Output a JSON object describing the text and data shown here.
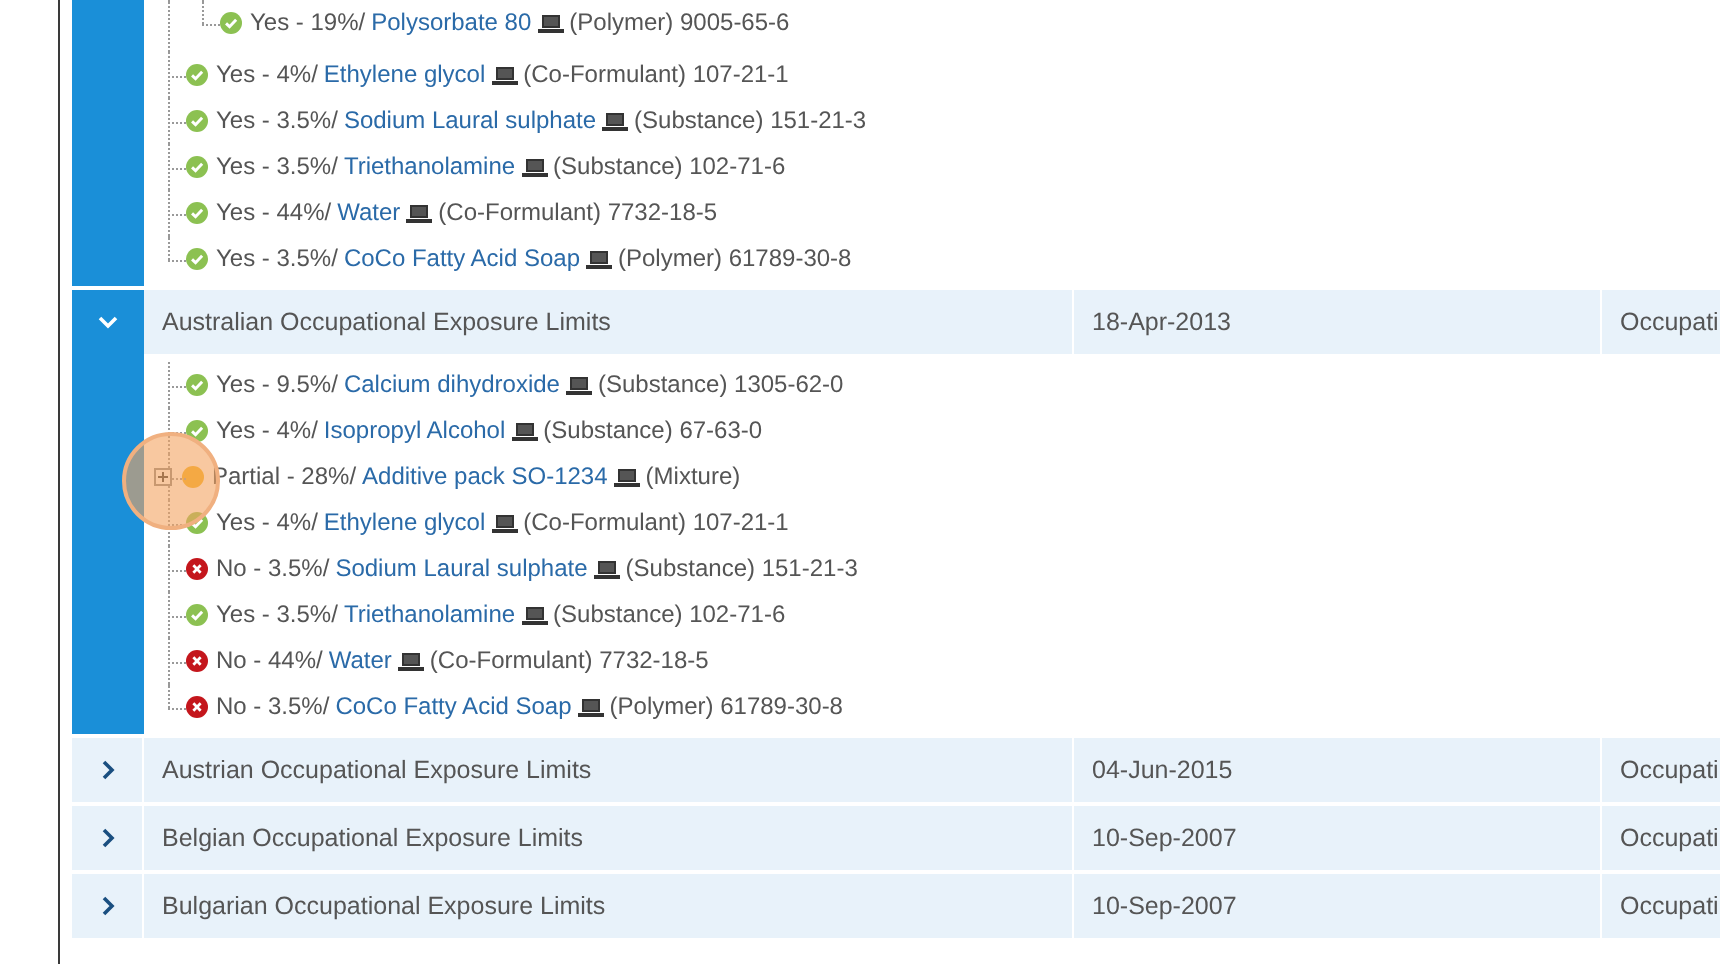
{
  "rows": [
    {
      "expanded": true,
      "items": [
        {
          "children": [
            {
              "kind": "yes",
              "prefix": "Yes - 19%/",
              "link": "Polysorbate 80",
              "suffix": "(Polymer) 9005-65-6"
            }
          ]
        },
        {
          "kind": "yes",
          "prefix": "Yes - 4%/",
          "link": "Ethylene glycol",
          "suffix": "(Co-Formulant) 107-21-1"
        },
        {
          "kind": "yes",
          "prefix": "Yes - 3.5%/",
          "link": "Sodium Laural sulphate",
          "suffix": "(Substance) 151-21-3"
        },
        {
          "kind": "yes",
          "prefix": "Yes - 3.5%/",
          "link": "Triethanolamine",
          "suffix": "(Substance) 102-71-6"
        },
        {
          "kind": "yes",
          "prefix": "Yes - 44%/",
          "link": "Water",
          "suffix": "(Co-Formulant) 7732-18-5"
        },
        {
          "kind": "yes",
          "prefix": "Yes - 3.5%/",
          "link": "CoCo Fatty Acid Soap",
          "suffix": "(Polymer) 61789-30-8"
        }
      ]
    },
    {
      "expanded": true,
      "name": "Australian Occupational Exposure Limits",
      "date": "18-Apr-2013",
      "column_3": "Occupati",
      "items": [
        {
          "kind": "yes",
          "prefix": "Yes - 9.5%/",
          "link": "Calcium dihydroxide",
          "suffix": "(Substance) 1305-62-0"
        },
        {
          "kind": "yes",
          "prefix": "Yes - 4%/",
          "link": "Isopropyl Alcohol",
          "suffix": "(Substance) 67-63-0"
        },
        {
          "kind": "partial",
          "prefix": "Partial - 28%/",
          "link": "Additive pack SO-1234",
          "suffix": "(Mixture)",
          "expanded": false
        },
        {
          "kind": "yes",
          "prefix": "Yes - 4%/",
          "link": "Ethylene glycol",
          "suffix": "(Co-Formulant) 107-21-1"
        },
        {
          "kind": "no",
          "prefix": "No - 3.5%/",
          "link": "Sodium Laural sulphate",
          "suffix": "(Substance) 151-21-3"
        },
        {
          "kind": "yes",
          "prefix": "Yes - 3.5%/",
          "link": "Triethanolamine",
          "suffix": "(Substance) 102-71-6"
        },
        {
          "kind": "no",
          "prefix": "No - 44%/",
          "link": "Water",
          "suffix": "(Co-Formulant) 7732-18-5"
        },
        {
          "kind": "no",
          "prefix": "No - 3.5%/",
          "link": "CoCo Fatty Acid Soap",
          "suffix": "(Polymer) 61789-30-8"
        }
      ]
    },
    {
      "expanded": false,
      "name": "Austrian Occupational Exposure Limits",
      "date": "04-Jun-2015",
      "column_3": "Occupati"
    },
    {
      "expanded": false,
      "name": "Belgian Occupational Exposure Limits",
      "date": "10-Sep-2007",
      "column_3": "Occupati"
    },
    {
      "expanded": false,
      "name": "Bulgarian Occupational Exposure Limits",
      "date": "10-Sep-2007",
      "column_3": "Occupati"
    }
  ]
}
